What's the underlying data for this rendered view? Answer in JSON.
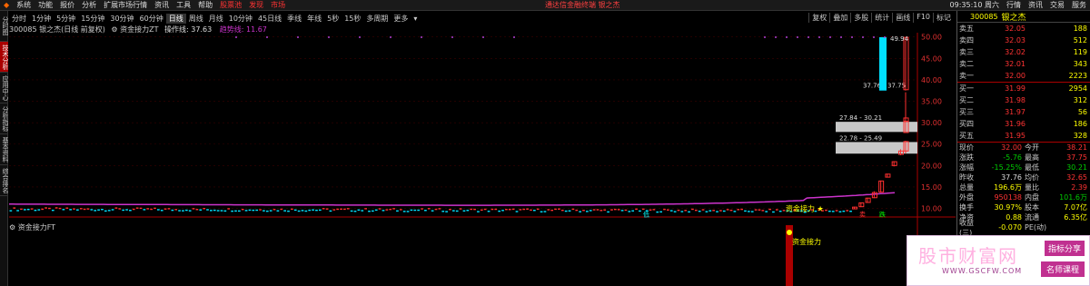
{
  "menu": {
    "items": [
      "系统",
      "功能",
      "报价",
      "分析",
      "扩展市场行情",
      "资讯",
      "工具",
      "帮助",
      "股票池",
      "发现",
      "市场"
    ],
    "red_items": [
      8,
      9,
      10
    ],
    "center_text": "通达信金融终端 银之杰",
    "right_items": [
      "09:35:10 周六",
      "行情",
      "资讯",
      "交易",
      "服务"
    ]
  },
  "left_tabs": [
    "分时图",
    "技术分析",
    "应用中心",
    "分析指标",
    "基本资料",
    "综合排名"
  ],
  "period_bar": {
    "periods": [
      "分时",
      "1分钟",
      "5分钟",
      "15分钟",
      "30分钟",
      "60分钟",
      "日线",
      "周线",
      "月线",
      "10分钟",
      "45日线",
      "季线",
      "年线",
      "5秒",
      "15秒",
      "多周期",
      "更多"
    ],
    "active": "日线",
    "right_tools": [
      "复权",
      "叠加",
      "多股",
      "统计",
      "画线",
      "F10",
      "标记"
    ]
  },
  "price_title": {
    "code_name": "300085 银之杰(日线 前复权)",
    "indicator": "资金接力ZT",
    "op_label": "操作线: 37.63",
    "trend_label": "趋势线: 11.67"
  },
  "indicator_title": "资金接力FT",
  "chart_data": {
    "type": "candlestick",
    "y_axis_ticks": [
      50.0,
      45.0,
      40.0,
      35.0,
      30.0,
      25.0,
      20.0,
      15.0,
      10.0
    ],
    "y_range": [
      8.0,
      51.0
    ],
    "n_bars": 240,
    "base_price": 9.8,
    "trend_line_start": 11.0,
    "trend_line_end": 11.67,
    "recent_candles": [
      {
        "o": 9.9,
        "h": 10.4,
        "l": 9.8,
        "c": 10.3
      },
      {
        "o": 10.4,
        "h": 11.4,
        "l": 10.3,
        "c": 11.3
      },
      {
        "o": 11.4,
        "h": 12.5,
        "l": 11.3,
        "c": 12.4
      },
      {
        "o": 12.5,
        "h": 14.0,
        "l": 12.4,
        "c": 13.7
      },
      {
        "o": 13.8,
        "h": 16.5,
        "l": 13.7,
        "c": 16.4
      },
      {
        "o": 17.3,
        "h": 18.1,
        "l": 17.3,
        "c": 18.0
      },
      {
        "o": 20.0,
        "h": 21.0,
        "l": 19.8,
        "c": 20.9
      },
      {
        "o": 22.6,
        "h": 23.8,
        "l": 22.4,
        "c": 23.4
      },
      {
        "o": 23.4,
        "h": 25.8,
        "l": 22.8,
        "c": 25.6
      },
      {
        "o": 27.7,
        "h": 30.5,
        "l": 27.6,
        "c": 30.3
      },
      {
        "o": 37.7,
        "h": 49.94,
        "l": 37.5,
        "c": 49.9
      },
      {
        "o": 30.3,
        "h": 37.1,
        "l": 30.2,
        "c": 31.1
      }
    ],
    "gap_zones": [
      {
        "low": 27.84,
        "high": 30.21,
        "label": "27.84 - 30.21"
      },
      {
        "low": 22.78,
        "high": 25.49,
        "label": "22.78 - 25.49"
      }
    ],
    "top_zone_label": "37.76 - 37.75",
    "high_label": "49.94",
    "signals": {
      "fund_relay": "资金接力",
      "sell": "卖",
      "low": "低",
      "dip": "跌"
    },
    "indicator_signal": "资金接力"
  },
  "right_panel": {
    "code": "300085",
    "name": "银之杰",
    "asks": [
      {
        "label": "卖五",
        "price": "32.05",
        "vol": "188"
      },
      {
        "label": "卖四",
        "price": "32.03",
        "vol": "512"
      },
      {
        "label": "卖三",
        "price": "32.02",
        "vol": "119"
      },
      {
        "label": "卖二",
        "price": "32.01",
        "vol": "343"
      },
      {
        "label": "卖一",
        "price": "32.00",
        "vol": "2223"
      }
    ],
    "bids": [
      {
        "label": "买一",
        "price": "31.99",
        "vol": "2954"
      },
      {
        "label": "买二",
        "price": "31.98",
        "vol": "312"
      },
      {
        "label": "买三",
        "price": "31.97",
        "vol": "56"
      },
      {
        "label": "买四",
        "price": "31.96",
        "vol": "186"
      },
      {
        "label": "买五",
        "price": "31.95",
        "vol": "328"
      }
    ],
    "quote": [
      {
        "l1": "现价",
        "v1": "32.00",
        "c1": "red",
        "l2": "今开",
        "v2": "38.21",
        "c2": "red"
      },
      {
        "l1": "涨跌",
        "v1": "-5.76",
        "c1": "green",
        "l2": "最高",
        "v2": "37.75",
        "c2": "red"
      },
      {
        "l1": "涨幅",
        "v1": "-15.25%",
        "c1": "green",
        "l2": "最低",
        "v2": "30.21",
        "c2": "green"
      },
      {
        "l1": "昨收",
        "v1": "37.76",
        "c1": "white",
        "l2": "均价",
        "v2": "32.65",
        "c2": "red"
      },
      {
        "l1": "总量",
        "v1": "196.6万",
        "c1": "yellow",
        "l2": "量比",
        "v2": "2.39",
        "c2": "red"
      },
      {
        "l1": "外盘",
        "v1": "950138",
        "c1": "red",
        "l2": "内盘",
        "v2": "101.6万",
        "c2": "green"
      },
      {
        "l1": "换手",
        "v1": "30.97%",
        "c1": "yellow",
        "l2": "股本",
        "v2": "7.07亿",
        "c2": "yellow"
      },
      {
        "l1": "净资",
        "v1": "0.88",
        "c1": "yellow",
        "l2": "流通",
        "v2": "6.35亿",
        "c2": "yellow"
      },
      {
        "l1": "收益(三)",
        "v1": "-0.070",
        "c1": "yellow",
        "l2": "PE(动)",
        "v2": "",
        "c2": "yellow"
      }
    ]
  },
  "brand": {
    "title": "股市财富网",
    "url": "WWW.GSCFW.COM",
    "tag1": "指标分享",
    "tag2": "名师课程"
  },
  "colors": {
    "up": "#ff3030",
    "down": "#00e0ff",
    "trend": "#cc33cc",
    "gap_zone": "#c8c8c8",
    "accent": "#ffff00"
  }
}
